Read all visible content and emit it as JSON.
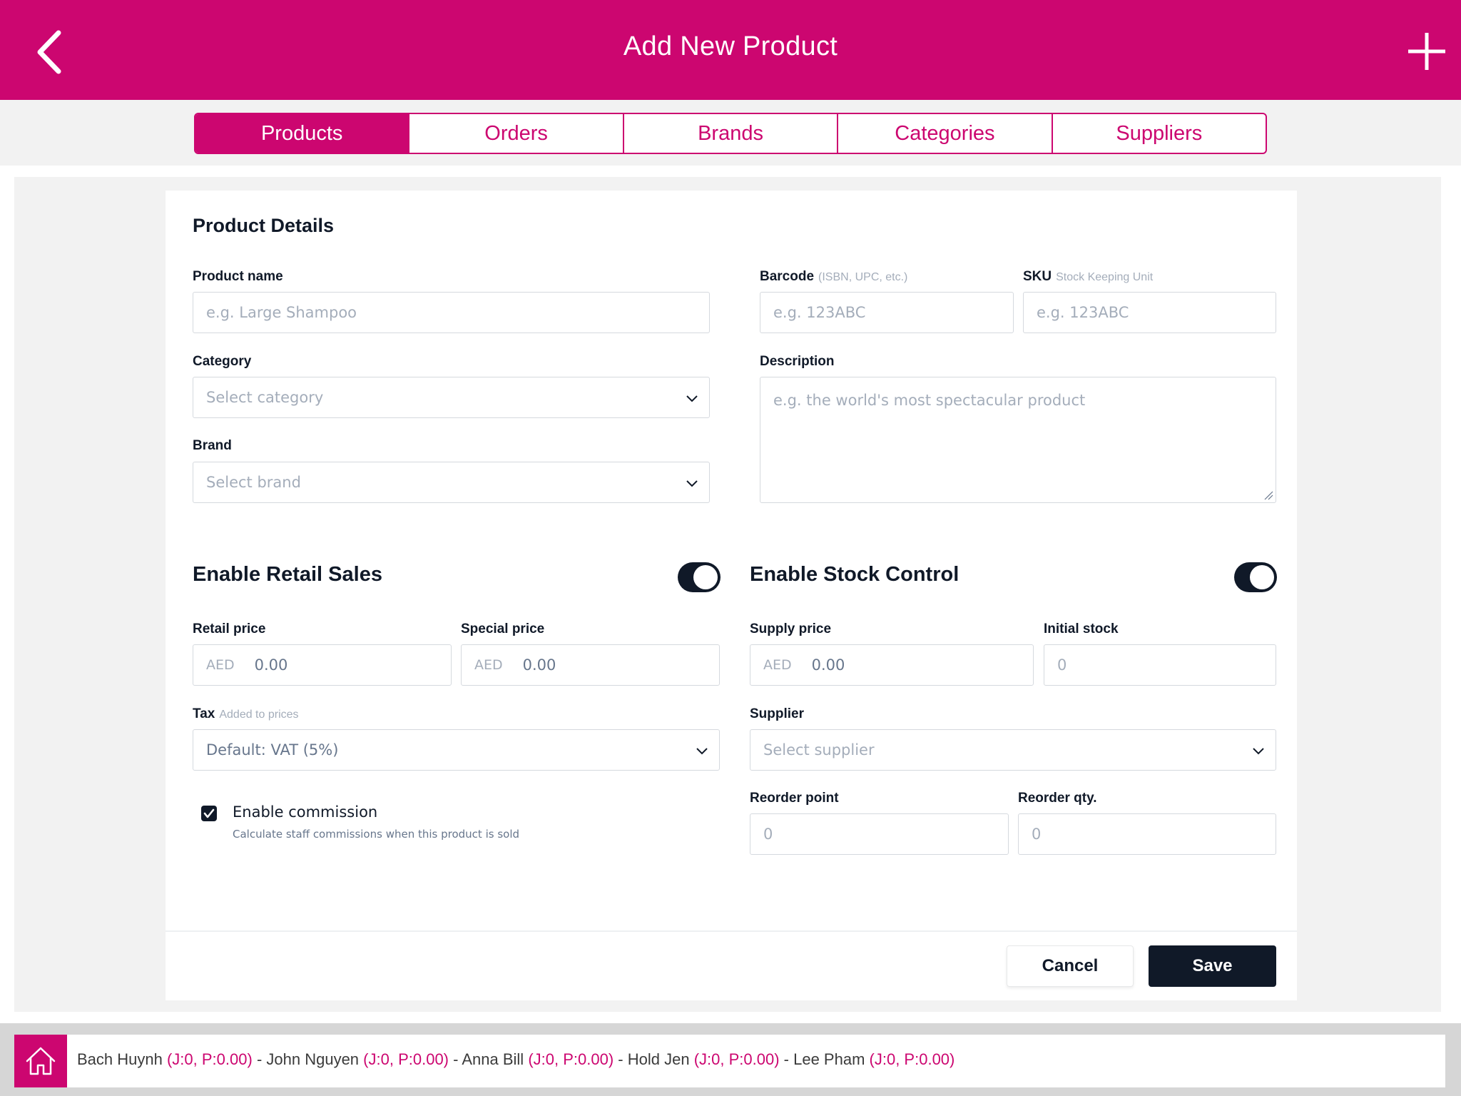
{
  "header": {
    "title": "Add New Product",
    "back_icon": "chevron-left-icon",
    "add_icon": "plus-icon"
  },
  "tabs": [
    {
      "label": "Products",
      "active": true
    },
    {
      "label": "Orders",
      "active": false
    },
    {
      "label": "Brands",
      "active": false
    },
    {
      "label": "Categories",
      "active": false
    },
    {
      "label": "Suppliers",
      "active": false
    }
  ],
  "details": {
    "title": "Product Details",
    "product_name": {
      "label": "Product name",
      "placeholder": "e.g. Large Shampoo"
    },
    "barcode": {
      "label": "Barcode",
      "hint": "(ISBN, UPC, etc.)",
      "placeholder": "e.g. 123ABC"
    },
    "sku": {
      "label": "SKU",
      "hint": "Stock Keeping Unit",
      "placeholder": "e.g. 123ABC"
    },
    "category": {
      "label": "Category",
      "placeholder": "Select category"
    },
    "description": {
      "label": "Description",
      "placeholder": "e.g. the world's most spectacular product"
    },
    "brand": {
      "label": "Brand",
      "placeholder": "Select brand"
    }
  },
  "retail": {
    "title": "Enable Retail Sales",
    "enabled": true,
    "retail_price": {
      "label": "Retail price",
      "currency": "AED",
      "value": "0.00"
    },
    "special_price": {
      "label": "Special price",
      "currency": "AED",
      "value": "0.00"
    },
    "tax": {
      "label": "Tax",
      "hint": "Added to prices",
      "value": "Default: VAT (5%)"
    },
    "commission": {
      "label": "Enable commission",
      "sub": "Calculate staff commissions when this product is sold",
      "checked": true
    }
  },
  "stock": {
    "title": "Enable Stock Control",
    "enabled": true,
    "supply_price": {
      "label": "Supply price",
      "currency": "AED",
      "value": "0.00"
    },
    "initial_stock": {
      "label": "Initial stock",
      "value": "0"
    },
    "supplier": {
      "label": "Supplier",
      "placeholder": "Select supplier"
    },
    "reorder_point": {
      "label": "Reorder point",
      "value": "0"
    },
    "reorder_qty": {
      "label": "Reorder qty.",
      "value": "0"
    }
  },
  "actions": {
    "cancel": "Cancel",
    "save": "Save"
  },
  "staff": [
    {
      "name": "Bach Huynh",
      "stats": "(J:0, P:0.00)"
    },
    {
      "name": "John Nguyen",
      "stats": "(J:0, P:0.00)"
    },
    {
      "name": "Anna Bill",
      "stats": "(J:0, P:0.00)"
    },
    {
      "name": "Hold Jen",
      "stats": "(J:0, P:0.00)"
    },
    {
      "name": "Lee Pham",
      "stats": "(J:0, P:0.00)"
    }
  ],
  "staff_separator": " - ",
  "home_icon": "home-icon",
  "colors": {
    "brand": "#cc0670",
    "dark": "#101928",
    "placeholder": "#a4adba"
  }
}
